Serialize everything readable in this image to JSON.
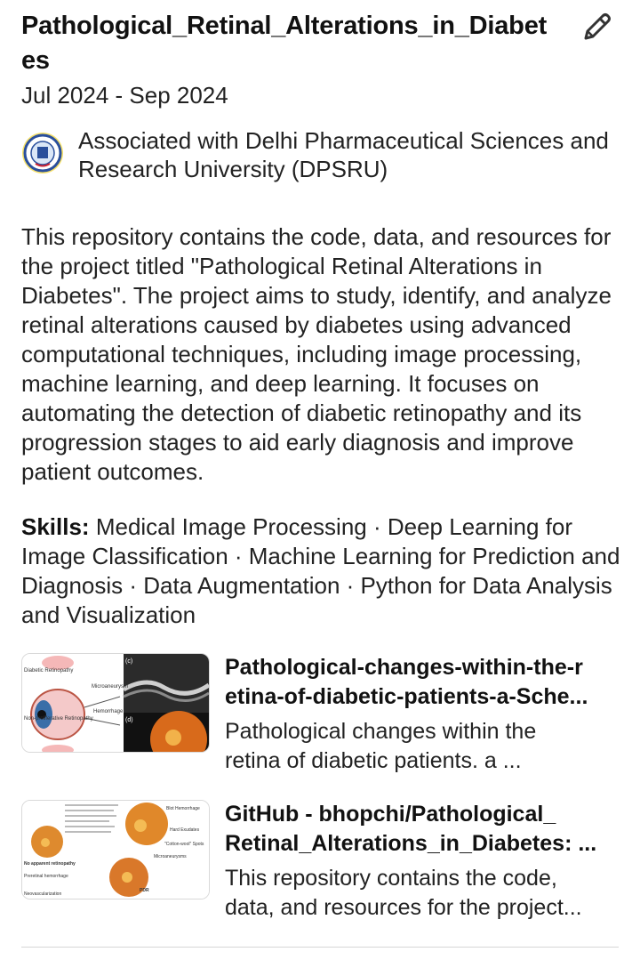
{
  "project": {
    "title": "Pathological_Retinal_Alterations_in_Diabetes",
    "dates": "Jul 2024 - Sep 2024",
    "association": "Associated with Delhi Pharmaceutical Sciences and Research University (DPSRU)",
    "description": "This repository contains the code, data, and resources for the project titled \"Pathological Retinal Alterations in Diabetes\". The project aims to study, identify, and analyze retinal alterations caused by diabetes using advanced computational techniques, including image processing, machine learning, and deep learning. It focuses on automating the detection of diabetic retinopathy and its progression stages to aid early diagnosis and improve patient outcomes.",
    "skills_label": "Skills:",
    "skills": "Medical Image Processing · Deep Learning for Image Classification · Machine Learning for Prediction and Diagnosis · Data Augmentation · Python for Data Analysis and Visualization"
  },
  "media": [
    {
      "title_line1": "Pathological-changes-within-the-r",
      "title_line2": "etina-of-diabetic-patients-a-Sche...",
      "desc_line1": "Pathological changes within the",
      "desc_line2": "retina of diabetic patients. a ...",
      "thumb_labels": {
        "diabetic": "Diabetic Retinopathy",
        "micro": "Microaneurysm",
        "hemorrhage": "Hemorrhage",
        "nonprolif": "Non-proliferative Retinopathy",
        "panel_c": "(c)",
        "panel_d": "(d)"
      }
    },
    {
      "title_line1": "GitHub - bhopchi/Pathological_",
      "title_line2": "Retinal_Alterations_in_Diabetes: ...",
      "desc_line1": "This repository contains the code,",
      "desc_line2": "data, and resources for the project...",
      "thumb_labels": {
        "blot": "Blot Hemorrhage",
        "hard": "Hard Exudates",
        "cotton": "\"Cotton-wool\" Spots",
        "micro": "Microaneurysms",
        "noapp": "No apparent retinopathy",
        "preret": "Preretinal hemorrhage",
        "neo": "Neovascularization",
        "pdr": "PDR"
      }
    }
  ],
  "icons": {
    "edit": "pencil-icon",
    "logo": "university-seal-logo"
  },
  "colors": {
    "text": "#222222",
    "title": "#111111",
    "divider": "#d6d6d6"
  }
}
